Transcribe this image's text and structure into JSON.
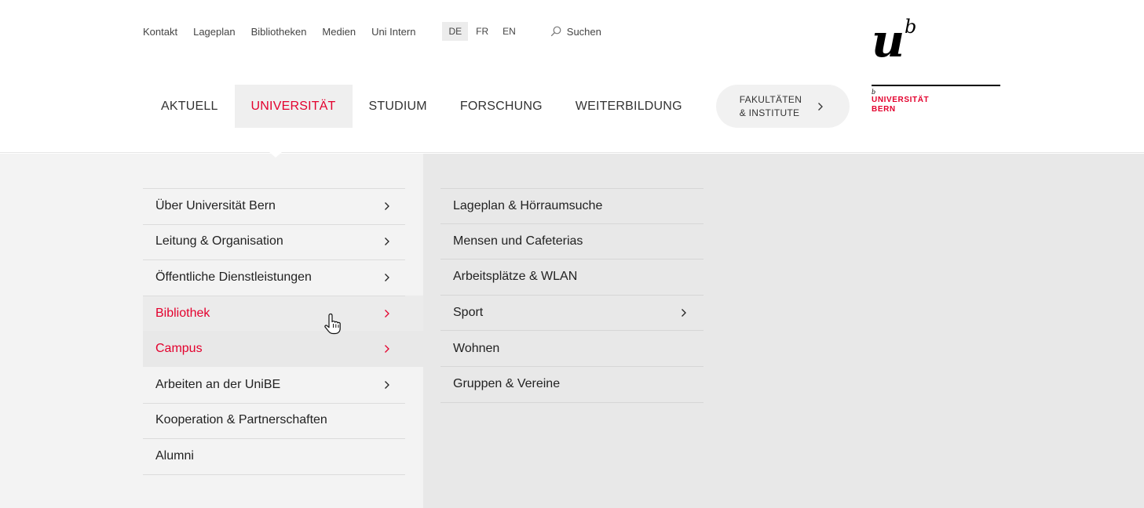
{
  "service_nav": {
    "links": [
      "Kontakt",
      "Lageplan",
      "Bibliotheken",
      "Medien",
      "Uni Intern"
    ],
    "languages": [
      "DE",
      "FR",
      "EN"
    ],
    "active_language": "DE",
    "search_label": "Suchen"
  },
  "main_nav": {
    "items": [
      "AKTUELL",
      "UNIVERSITÄT",
      "STUDIUM",
      "FORSCHUNG",
      "WEITERBILDUNG"
    ],
    "active": "UNIVERSITÄT",
    "faculties_line1": "FAKULTÄTEN",
    "faculties_line2": "& INSTITUTE"
  },
  "logo": {
    "mark_u": "u",
    "mark_b": "b",
    "small_b": "b",
    "line1": "UNIVERSITÄT",
    "line2": "BERN"
  },
  "menu_level1": {
    "items": [
      {
        "label": "Über Universität Bern",
        "has_children": true,
        "state": "normal"
      },
      {
        "label": "Leitung & Organisation",
        "has_children": true,
        "state": "normal"
      },
      {
        "label": "Öffentliche Dienstleistungen",
        "has_children": true,
        "state": "normal"
      },
      {
        "label": "Bibliothek",
        "has_children": true,
        "state": "hover"
      },
      {
        "label": "Campus",
        "has_children": true,
        "state": "selected"
      },
      {
        "label": "Arbeiten an der UniBE",
        "has_children": true,
        "state": "normal"
      },
      {
        "label": "Kooperation & Partnerschaften",
        "has_children": false,
        "state": "normal"
      },
      {
        "label": "Alumni",
        "has_children": false,
        "state": "normal"
      }
    ]
  },
  "menu_level2": {
    "items": [
      {
        "label": "Lageplan & Hörraumsuche",
        "has_children": false
      },
      {
        "label": "Mensen und Cafeterias",
        "has_children": false
      },
      {
        "label": "Arbeitsplätze & WLAN",
        "has_children": false
      },
      {
        "label": "Sport",
        "has_children": true
      },
      {
        "label": "Wohnen",
        "has_children": false
      },
      {
        "label": "Gruppen & Vereine",
        "has_children": false
      }
    ]
  },
  "colors": {
    "accent": "#e3002d",
    "text": "#222222",
    "menu_bg_left": "#f3f3f3",
    "menu_bg_right": "#e8e8e8"
  },
  "icons": {
    "search": "magnifier-icon",
    "chevron": "chevron-right-icon",
    "cursor": "hand-pointer-icon"
  }
}
